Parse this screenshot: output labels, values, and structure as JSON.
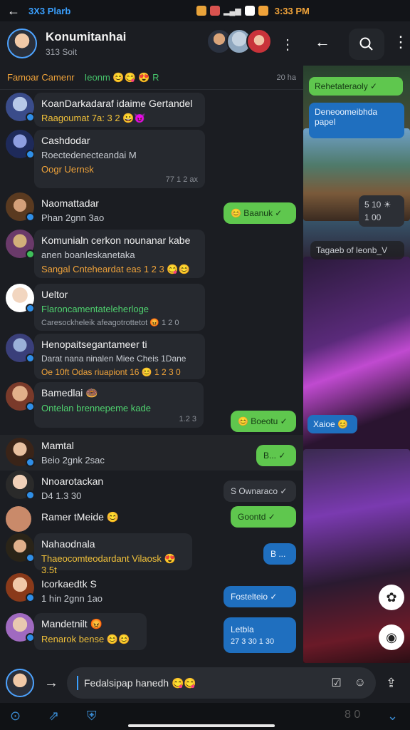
{
  "status_bar": {
    "back": "←",
    "carrier": "3X3 Plarb",
    "clock": "3:33 PM",
    "signal": "▂▄▆",
    "colors": [
      "#e8a33a",
      "#d9534f",
      "#ffffff",
      "#f0a33a"
    ]
  },
  "chat_header": {
    "title": "Konumitanhai",
    "subtitle": "313 Soit",
    "more": "⋮"
  },
  "banner": {
    "left": "Famoar Camenr",
    "mid": "Ieonm 😊😋 😍 R",
    "right": "20 ha"
  },
  "chats": [
    {
      "name": "KoanDarkadaraf idaime Gertandel",
      "line": "Raagoumat 7a: 3 2 😀😈",
      "line_color": "yellow"
    },
    {
      "name": "Cashdodar",
      "line": "Roectedenecteandai M",
      "line2": "Oogr Uernsk",
      "time": "77 1 2 ax",
      "line2_color": "orange"
    },
    {
      "name": "Naomattadar",
      "line": "Phan 2gnn 3ao"
    },
    {
      "name": "Komunialn cerkon nounanar kabe",
      "line": "anen boanIeskanetaka",
      "line2": "Sangal Cnteheardat eas 1 2 3 😋😊",
      "line2_color": "orange"
    },
    {
      "name": "Ueltor",
      "line": "Flaroncamentateleherloge",
      "line2": "Caresockheleik afeagotrottetot 😡 1 2 0",
      "line_color": "green"
    },
    {
      "name": "Henopaitsegantameer ti",
      "line": "Darat nana ninalen Miee Cheis 1Dane",
      "line2": "Oe 10ft Odas riuapiont 16 😊 1 2 3 0",
      "line2_color": "orange"
    },
    {
      "name": "Bamedlai 🍩",
      "line": "Ontelan brennepeme kade",
      "time": "1.2 3",
      "line_color": "green"
    },
    {
      "name": "Mamtal",
      "line": "Beio 2gnk 2sac"
    },
    {
      "name": "Nnoarotackan",
      "line": "D4 1.3 30"
    },
    {
      "name": "Ramer tMeide 😊",
      "line": ""
    },
    {
      "name": "Nahaodnala",
      "line": "Thaeocomteodardant Vilaosk 😍 3.5t",
      "line_color": "yellow"
    },
    {
      "name": "Icorkaedtk S",
      "line": "1 hin 2gnn 1ao"
    },
    {
      "name": "Mandetnilt 😡",
      "line": "Renarok bense 😊😊",
      "line_color": "yellow"
    }
  ],
  "reactions": [
    {
      "text": "😊 Baanuk ✓",
      "style": "green"
    },
    {
      "text": "😊 Boeotu ✓",
      "style": "green"
    },
    {
      "text": "B... ✓",
      "style": "green"
    },
    {
      "text": "S Ownaraco ✓",
      "style": "gray"
    },
    {
      "text": "Goontd ✓",
      "style": "green"
    },
    {
      "text": "B ...",
      "style": "blue"
    },
    {
      "text": "Fostelteio ✓",
      "style": "blue"
    },
    {
      "text": "Letbla",
      "style": "blue",
      "time": "27 3 30    1 30"
    }
  ],
  "right_panel": {
    "back": "←",
    "search": "search",
    "more": "⋮",
    "pill1": "Rehetateraoly ✓",
    "pill2": "Deneoomeibhda papel",
    "pill3": "5 10    ☀",
    "pill3b": "1 00",
    "pill4": "Tagaeb of leonb_V",
    "pill5": "Xaioe 😊"
  },
  "composer": {
    "value": "Fedalsipap hanedh 😋😋",
    "arrow": "→"
  },
  "nav": {
    "left_label": "8 0"
  }
}
